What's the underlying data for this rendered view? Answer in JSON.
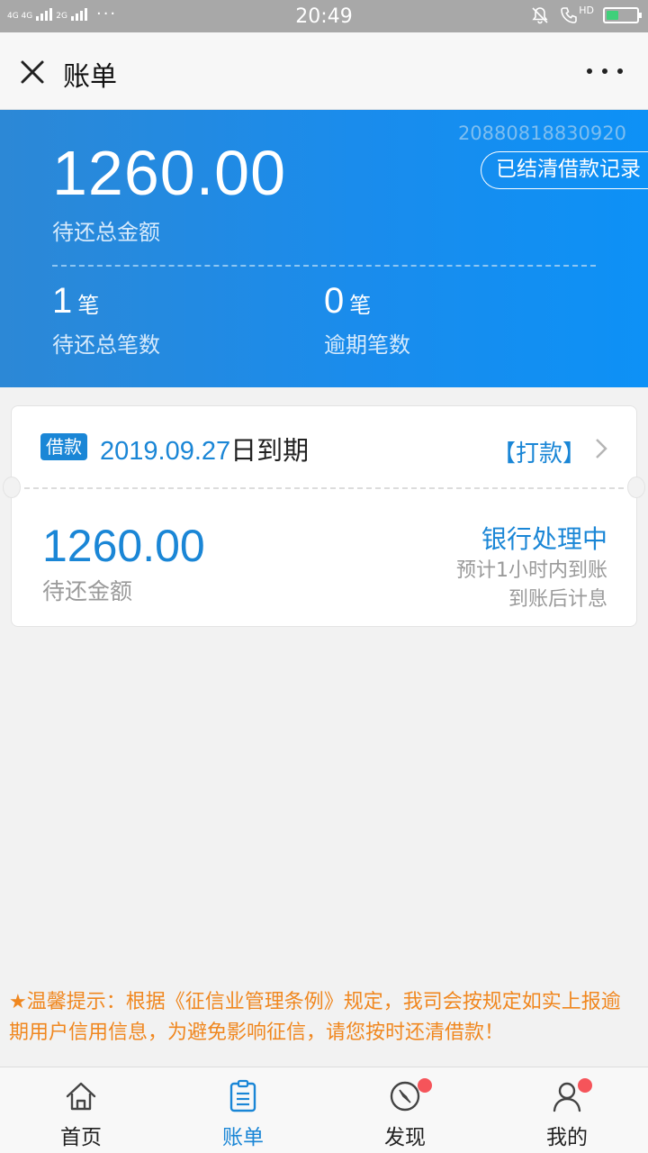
{
  "status_bar": {
    "signal_label_1": "4G 4G",
    "signal_label_2": "2G",
    "dots": "···",
    "time": "20:49",
    "hd_label": "HD",
    "battery_level": 0.4,
    "battery_color": "#3fd07a"
  },
  "nav": {
    "close_icon": "close-icon",
    "title": "账单",
    "more_icon": "more-icon"
  },
  "summary": {
    "serial": "20880818830920",
    "records_button": "已结清借款记录",
    "total_amount": "1260.00",
    "total_label": "待还总金额",
    "count_value": "1",
    "count_unit": "笔",
    "count_label": "待还总笔数",
    "overdue_value": "0",
    "overdue_unit": "笔",
    "overdue_label": "逾期笔数"
  },
  "bill": {
    "tag": "借款",
    "due_date": "2019.09.27",
    "due_suffix": "日到期",
    "action": "【打款】",
    "amount": "1260.00",
    "amount_label": "待还金额",
    "status": "银行处理中",
    "status_note_1": "预计1小时内到账",
    "status_note_2": "到账后计息"
  },
  "notice": {
    "text": "★温馨提示：根据《征信业管理条例》规定，我司会按规定如实上报逾期用户信用信息，为避免影响征信，请您按时还清借款！"
  },
  "tabs": [
    {
      "label": "首页",
      "icon": "home-icon",
      "active": false,
      "badge": false
    },
    {
      "label": "账单",
      "icon": "bill-icon",
      "active": true,
      "badge": false
    },
    {
      "label": "发现",
      "icon": "compass-icon",
      "active": false,
      "badge": true
    },
    {
      "label": "我的",
      "icon": "user-icon",
      "active": false,
      "badge": true
    }
  ],
  "colors": {
    "accent": "#1a86d6",
    "header_blue": "#1a8cec",
    "notice_orange": "#f0871f",
    "badge_red": "#f5545a"
  }
}
